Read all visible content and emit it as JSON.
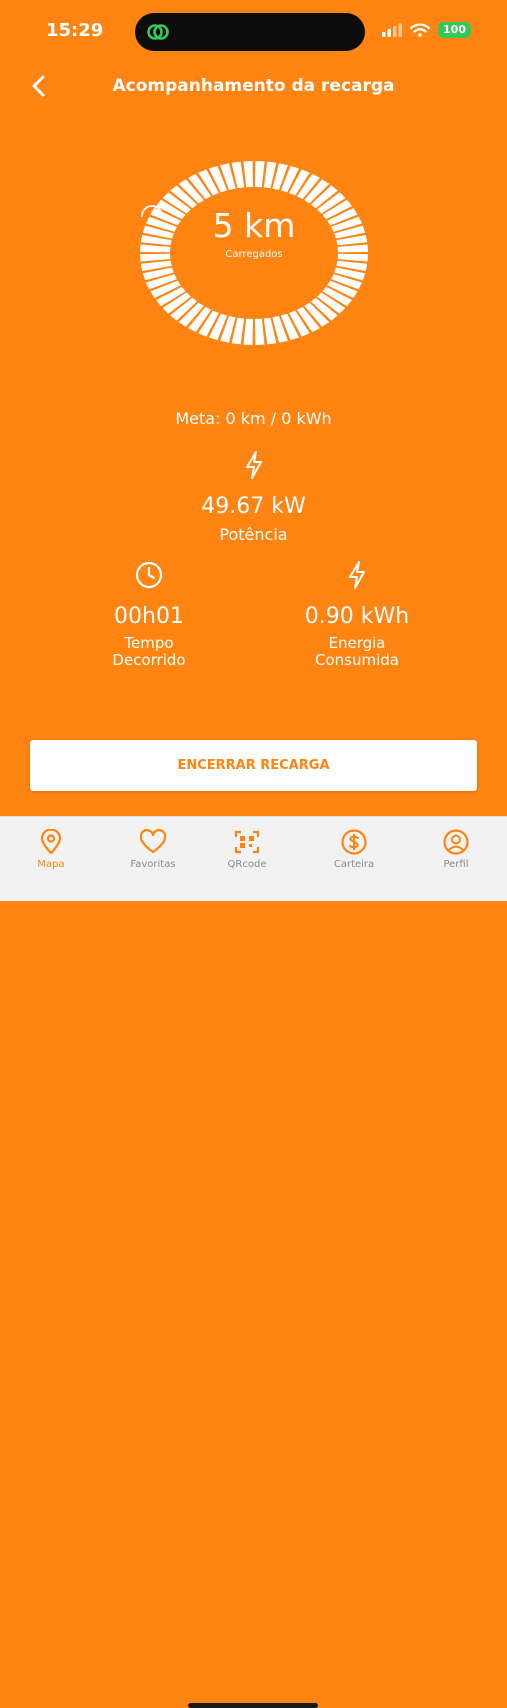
{
  "status_bar": {
    "time": "15:29",
    "battery": "100"
  },
  "header": {
    "title": "Acompanhamento da recarga",
    "back_icon": "chevron-left-icon"
  },
  "charge": {
    "distance": "5 km",
    "distance_label": "Carregados"
  },
  "goal": {
    "text": "Meta: 0 km / 0 kWh"
  },
  "power": {
    "value": "49.67 kW",
    "label": "Potência"
  },
  "elapsed": {
    "value": "00h01",
    "label_line1": "Tempo",
    "label_line2": "Decorrido"
  },
  "energy": {
    "value": "0.90 kWh",
    "label_line1": "Energia",
    "label_line2": "Consumida"
  },
  "actions": {
    "end_charge": "ENCERRAR RECARGA"
  },
  "tabs": [
    {
      "label": "Mapa",
      "icon": "map-pin-icon",
      "active": true
    },
    {
      "label": "Favoritas",
      "icon": "heart-icon",
      "active": false
    },
    {
      "label": "QRcode",
      "icon": "qrcode-icon",
      "active": false
    },
    {
      "label": "Carteira",
      "icon": "dollar-icon",
      "active": false
    },
    {
      "label": "Perfil",
      "icon": "profile-icon",
      "active": false
    }
  ],
  "colors": {
    "primary": "#FF8412",
    "white": "#FFFFFF",
    "tab_bar": "#F2F2F2",
    "tab_inactive": "#8A8A8A"
  }
}
